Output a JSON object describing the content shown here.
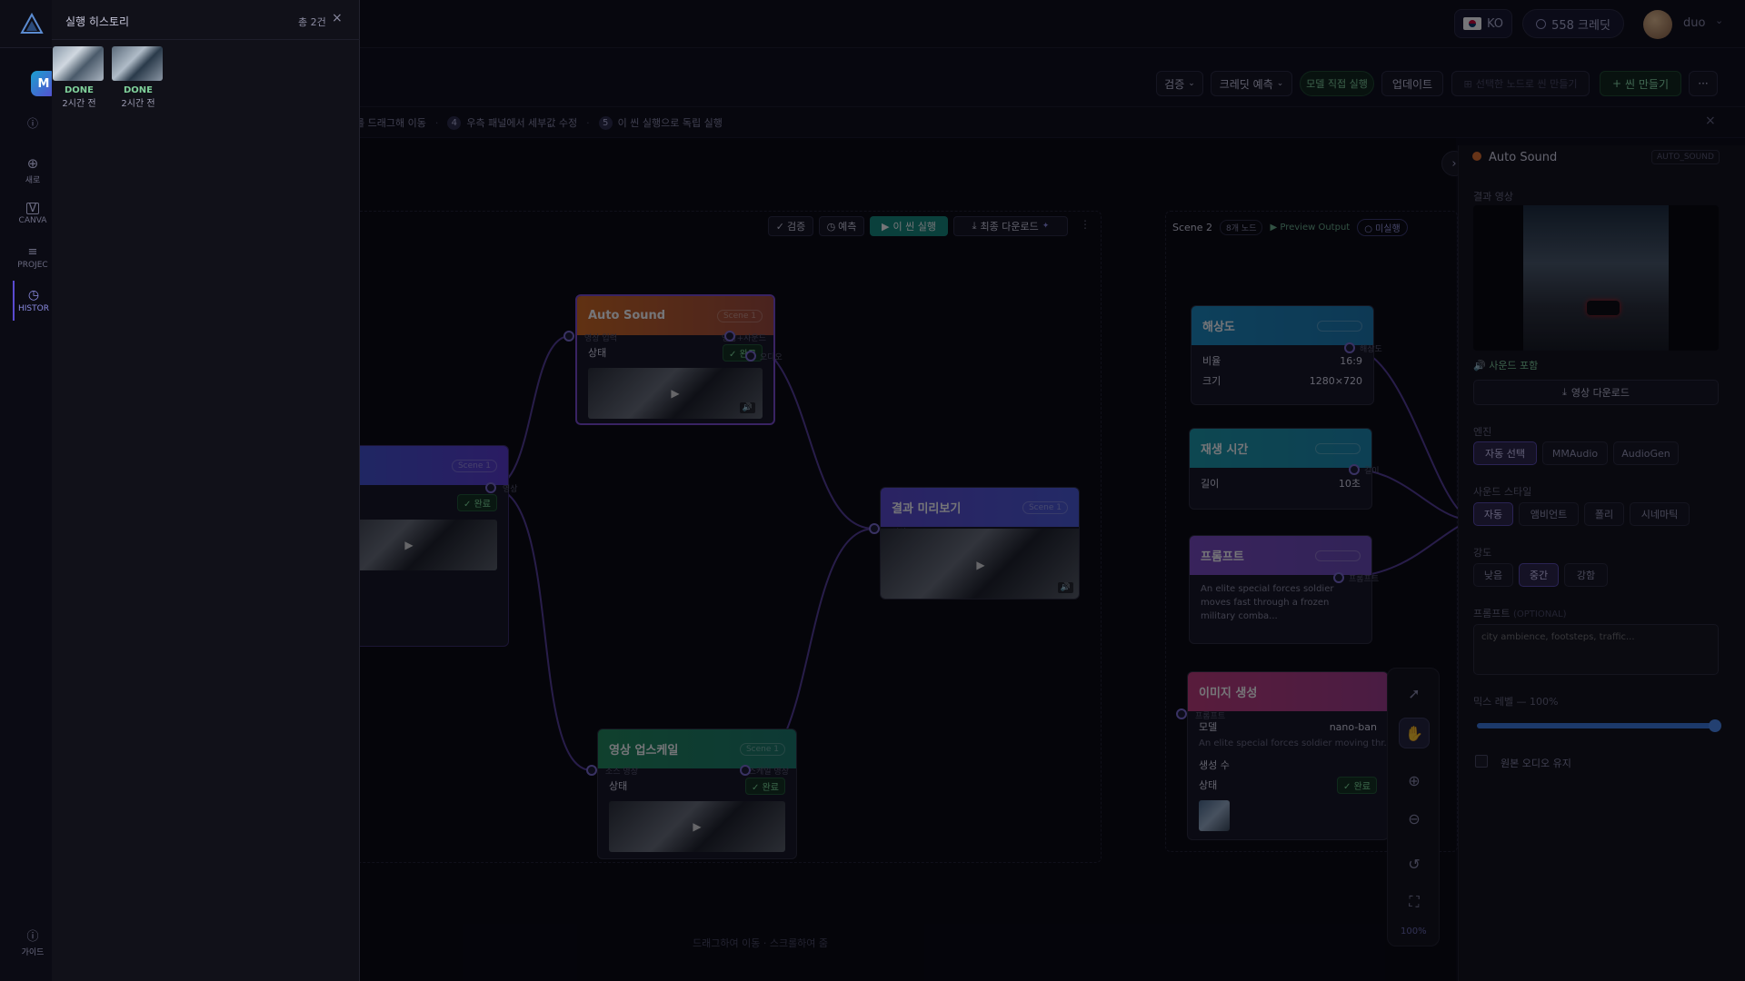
{
  "header": {
    "lang_code": "KO",
    "credits_label": "558 크레딧",
    "user_name": "duo"
  },
  "toolbar": {
    "verify_label": "검증",
    "credit_estimate_label": "크레딧 예측",
    "model_direct_run_label": "모델 직접 실행",
    "update_label": "업데이트",
    "selected_to_scene_label": "선택한 노드로 씬 만들기",
    "new_scene_label": "씬 만들기",
    "more_label": "···"
  },
  "steps": {
    "step3_text": "를 드래그해 이동",
    "step4_num": "4",
    "step4_text": "우측 패널에서 세부값 수정",
    "step5_num": "5",
    "step5_text": "이 씬 실행으로 독립 실행"
  },
  "rail": {
    "items": [
      {
        "label": "새로",
        "icon": "plus-circle-icon"
      },
      {
        "label": "CANVA",
        "icon": "canvas-icon"
      },
      {
        "label": "PROJEC",
        "icon": "project-icon"
      },
      {
        "label": "HISTOR",
        "icon": "clock-icon"
      }
    ],
    "guide_label": "가이드"
  },
  "history": {
    "title": "실행 히스토리",
    "count": "총 2건",
    "items": [
      {
        "status": "DONE",
        "time": "2시간 전"
      },
      {
        "status": "DONE",
        "time": "2시간 전"
      }
    ]
  },
  "scene1": {
    "verify_label": "검증",
    "estimate_label": "예측",
    "run_label": "이 씬 실행",
    "download_label": "최종 다운로드"
  },
  "nodes": {
    "auto_sound": {
      "title": "Auto Sound",
      "tag": "Scene 1",
      "in_port": "영상 입력",
      "out_port": "영상+사운드",
      "out_port2": "오디오",
      "status_key": "상태",
      "status_val": "완료"
    },
    "left_node": {
      "tag": "Scene 1",
      "port": "영상",
      "status_val": "완료"
    },
    "preview": {
      "title": "결과 미리보기",
      "tag": "Scene 1",
      "port": "영상"
    },
    "upscale": {
      "title": "영상 업스케일",
      "tag": "Scene 1",
      "in_port": "소스 영상",
      "out_port": "업스케일 영상",
      "status_key": "상태",
      "status_val": "완료"
    },
    "resolution": {
      "title": "해상도",
      "port": "해상도",
      "ratio_key": "비율",
      "ratio_val": "16:9",
      "size_key": "크기",
      "size_val": "1280×720"
    },
    "duration": {
      "title": "재생 시간",
      "port": "길이",
      "len_key": "길이",
      "len_val": "10초"
    },
    "prompt": {
      "title": "프롬프트",
      "port": "프롬프트",
      "text": "An elite special forces soldier moves fast through a frozen military comba..."
    },
    "image_gen": {
      "title": "이미지 생성",
      "port": "프롬프트",
      "model_key": "모델",
      "model_val": "nano-ban",
      "text": "An elite special forces soldier moving thr...",
      "count_key": "생성 수",
      "status_key": "상태",
      "status_val": "완료"
    }
  },
  "scene2": {
    "title": "Scene 2",
    "node_count": "8개 노드",
    "preview_output": "Preview Output",
    "not_run": "미실행"
  },
  "canvas_hint": "드래그하여 이동 · 스크롤하여 줌",
  "zoom": {
    "level": "100%"
  },
  "right_panel": {
    "node_title": "Auto Sound",
    "node_type": "AUTO_SOUND",
    "result_video_label": "결과 영상",
    "sound_included": "사운드 포함",
    "download_label": "영상 다운로드",
    "engine_label": "엔진",
    "engines": [
      "자동 선택",
      "MMAudio",
      "AudioGen"
    ],
    "sound_style_label": "사운드 스타일",
    "styles": [
      "자동",
      "앰비언트",
      "폴리",
      "시네마틱"
    ],
    "intensity_label": "강도",
    "intensities": [
      "낮음",
      "중간",
      "강함"
    ],
    "prompt_label": "프롬프트",
    "prompt_optional": "(OPTIONAL)",
    "prompt_placeholder": "city ambience, footsteps, traffic...",
    "mix_label": "믹스 레벨 — 100%",
    "mix_level": 1.0,
    "keep_audio_label": "원본 오디오 유지"
  },
  "colors": {
    "accent": "#7a5af0",
    "auto_sound_head": "#d2691e",
    "preview_head": "#5a4ad0",
    "upscale_head": "#1f8a5a",
    "resolution_head": "#1a8abf",
    "duration_head": "#1a9aa8",
    "prompt_head": "#7a4ac0",
    "image_head": "#c03a7a",
    "ok_green": "#7fe09a"
  }
}
